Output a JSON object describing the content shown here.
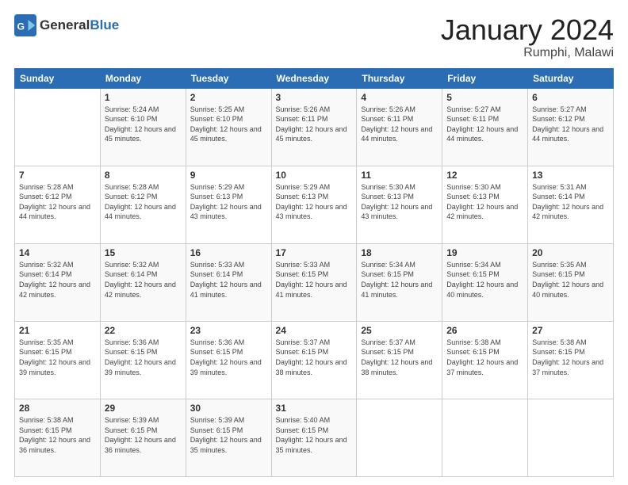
{
  "header": {
    "logo": {
      "general": "General",
      "blue": "Blue"
    },
    "title": "January 2024",
    "location": "Rumphi, Malawi"
  },
  "days_of_week": [
    "Sunday",
    "Monday",
    "Tuesday",
    "Wednesday",
    "Thursday",
    "Friday",
    "Saturday"
  ],
  "weeks": [
    [
      {
        "day": "",
        "sunrise": "",
        "sunset": "",
        "daylight": ""
      },
      {
        "day": "1",
        "sunrise": "Sunrise: 5:24 AM",
        "sunset": "Sunset: 6:10 PM",
        "daylight": "Daylight: 12 hours and 45 minutes."
      },
      {
        "day": "2",
        "sunrise": "Sunrise: 5:25 AM",
        "sunset": "Sunset: 6:10 PM",
        "daylight": "Daylight: 12 hours and 45 minutes."
      },
      {
        "day": "3",
        "sunrise": "Sunrise: 5:26 AM",
        "sunset": "Sunset: 6:11 PM",
        "daylight": "Daylight: 12 hours and 45 minutes."
      },
      {
        "day": "4",
        "sunrise": "Sunrise: 5:26 AM",
        "sunset": "Sunset: 6:11 PM",
        "daylight": "Daylight: 12 hours and 44 minutes."
      },
      {
        "day": "5",
        "sunrise": "Sunrise: 5:27 AM",
        "sunset": "Sunset: 6:11 PM",
        "daylight": "Daylight: 12 hours and 44 minutes."
      },
      {
        "day": "6",
        "sunrise": "Sunrise: 5:27 AM",
        "sunset": "Sunset: 6:12 PM",
        "daylight": "Daylight: 12 hours and 44 minutes."
      }
    ],
    [
      {
        "day": "7",
        "sunrise": "Sunrise: 5:28 AM",
        "sunset": "Sunset: 6:12 PM",
        "daylight": "Daylight: 12 hours and 44 minutes."
      },
      {
        "day": "8",
        "sunrise": "Sunrise: 5:28 AM",
        "sunset": "Sunset: 6:12 PM",
        "daylight": "Daylight: 12 hours and 44 minutes."
      },
      {
        "day": "9",
        "sunrise": "Sunrise: 5:29 AM",
        "sunset": "Sunset: 6:13 PM",
        "daylight": "Daylight: 12 hours and 43 minutes."
      },
      {
        "day": "10",
        "sunrise": "Sunrise: 5:29 AM",
        "sunset": "Sunset: 6:13 PM",
        "daylight": "Daylight: 12 hours and 43 minutes."
      },
      {
        "day": "11",
        "sunrise": "Sunrise: 5:30 AM",
        "sunset": "Sunset: 6:13 PM",
        "daylight": "Daylight: 12 hours and 43 minutes."
      },
      {
        "day": "12",
        "sunrise": "Sunrise: 5:30 AM",
        "sunset": "Sunset: 6:13 PM",
        "daylight": "Daylight: 12 hours and 42 minutes."
      },
      {
        "day": "13",
        "sunrise": "Sunrise: 5:31 AM",
        "sunset": "Sunset: 6:14 PM",
        "daylight": "Daylight: 12 hours and 42 minutes."
      }
    ],
    [
      {
        "day": "14",
        "sunrise": "Sunrise: 5:32 AM",
        "sunset": "Sunset: 6:14 PM",
        "daylight": "Daylight: 12 hours and 42 minutes."
      },
      {
        "day": "15",
        "sunrise": "Sunrise: 5:32 AM",
        "sunset": "Sunset: 6:14 PM",
        "daylight": "Daylight: 12 hours and 42 minutes."
      },
      {
        "day": "16",
        "sunrise": "Sunrise: 5:33 AM",
        "sunset": "Sunset: 6:14 PM",
        "daylight": "Daylight: 12 hours and 41 minutes."
      },
      {
        "day": "17",
        "sunrise": "Sunrise: 5:33 AM",
        "sunset": "Sunset: 6:15 PM",
        "daylight": "Daylight: 12 hours and 41 minutes."
      },
      {
        "day": "18",
        "sunrise": "Sunrise: 5:34 AM",
        "sunset": "Sunset: 6:15 PM",
        "daylight": "Daylight: 12 hours and 41 minutes."
      },
      {
        "day": "19",
        "sunrise": "Sunrise: 5:34 AM",
        "sunset": "Sunset: 6:15 PM",
        "daylight": "Daylight: 12 hours and 40 minutes."
      },
      {
        "day": "20",
        "sunrise": "Sunrise: 5:35 AM",
        "sunset": "Sunset: 6:15 PM",
        "daylight": "Daylight: 12 hours and 40 minutes."
      }
    ],
    [
      {
        "day": "21",
        "sunrise": "Sunrise: 5:35 AM",
        "sunset": "Sunset: 6:15 PM",
        "daylight": "Daylight: 12 hours and 39 minutes."
      },
      {
        "day": "22",
        "sunrise": "Sunrise: 5:36 AM",
        "sunset": "Sunset: 6:15 PM",
        "daylight": "Daylight: 12 hours and 39 minutes."
      },
      {
        "day": "23",
        "sunrise": "Sunrise: 5:36 AM",
        "sunset": "Sunset: 6:15 PM",
        "daylight": "Daylight: 12 hours and 39 minutes."
      },
      {
        "day": "24",
        "sunrise": "Sunrise: 5:37 AM",
        "sunset": "Sunset: 6:15 PM",
        "daylight": "Daylight: 12 hours and 38 minutes."
      },
      {
        "day": "25",
        "sunrise": "Sunrise: 5:37 AM",
        "sunset": "Sunset: 6:15 PM",
        "daylight": "Daylight: 12 hours and 38 minutes."
      },
      {
        "day": "26",
        "sunrise": "Sunrise: 5:38 AM",
        "sunset": "Sunset: 6:15 PM",
        "daylight": "Daylight: 12 hours and 37 minutes."
      },
      {
        "day": "27",
        "sunrise": "Sunrise: 5:38 AM",
        "sunset": "Sunset: 6:15 PM",
        "daylight": "Daylight: 12 hours and 37 minutes."
      }
    ],
    [
      {
        "day": "28",
        "sunrise": "Sunrise: 5:38 AM",
        "sunset": "Sunset: 6:15 PM",
        "daylight": "Daylight: 12 hours and 36 minutes."
      },
      {
        "day": "29",
        "sunrise": "Sunrise: 5:39 AM",
        "sunset": "Sunset: 6:15 PM",
        "daylight": "Daylight: 12 hours and 36 minutes."
      },
      {
        "day": "30",
        "sunrise": "Sunrise: 5:39 AM",
        "sunset": "Sunset: 6:15 PM",
        "daylight": "Daylight: 12 hours and 35 minutes."
      },
      {
        "day": "31",
        "sunrise": "Sunrise: 5:40 AM",
        "sunset": "Sunset: 6:15 PM",
        "daylight": "Daylight: 12 hours and 35 minutes."
      },
      {
        "day": "",
        "sunrise": "",
        "sunset": "",
        "daylight": ""
      },
      {
        "day": "",
        "sunrise": "",
        "sunset": "",
        "daylight": ""
      },
      {
        "day": "",
        "sunrise": "",
        "sunset": "",
        "daylight": ""
      }
    ]
  ]
}
